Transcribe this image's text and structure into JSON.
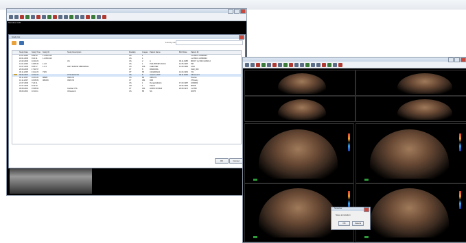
{
  "left_window": {
    "title": "",
    "meta_left": [
      "Sonoline G20",
      "",
      ""
    ],
    "meta_right": [
      "",
      "",
      ""
    ],
    "bottom_meta": [
      "",
      "",
      ""
    ]
  },
  "study_dialog": {
    "title": "Study list",
    "find_label": "Find by name:",
    "columns": [
      "Study Date",
      "Study Time",
      "Study ID",
      "Study Description",
      "Modality",
      "Images",
      "Patient Name",
      "Birth Date",
      "Patient ID"
    ],
    "rows": [
      [
        "11.01.2000",
        "8:55:02",
        "1.2.840.113",
        "",
        "US",
        "1",
        "",
        "",
        "1.2.826.0.1.3680043"
      ],
      [
        "18.01.2000",
        "9:14:11",
        "1.2.840.113",
        "",
        "US",
        "1",
        "",
        "",
        "1.2.826.0.1.3680043"
      ],
      [
        "21.02.2000",
        "10:43:23",
        "",
        "US",
        "US",
        "2",
        "A",
        "09.11.1958",
        "MR/CT 1.2.840.113619.2"
      ],
      [
        "11.04.2000",
        "13:56:33",
        "1.2.8",
        "",
        "US",
        "1",
        "PHILIPPINES FACE",
        "12.05.1987",
        "PM"
      ],
      [
        "01.07.2005",
        "8:06:07",
        "1.2.3",
        "LEFT ELBOW ABNORMAL",
        "US",
        "166",
        "CHESTER",
        "12.09.1980",
        "1234"
      ],
      [
        "20.09.2005",
        "17:31:57",
        "",
        "",
        "CT",
        "8",
        "PANDORA",
        "",
        "0110_000"
      ],
      [
        "30.11.2005",
        "13:12:23",
        "7329",
        "",
        "OT",
        "68",
        "CANADIANA",
        "12.04.1962",
        "721"
      ],
      [
        "09.06.2007",
        "10:22:22",
        "",
        "CTS obstetrics",
        "US",
        "5",
        "Anatoma FAT",
        "09.11.2003",
        "Ultrasound"
      ],
      [
        "06.11.2007",
        "10:03:26",
        "88885",
        "OB/GYN",
        "US",
        "88",
        "OB/GYN",
        "",
        "Precise"
      ],
      [
        "16.11.2007",
        "16:08:09",
        "084066",
        "OB/GYN",
        "CT",
        "481",
        "PAB",
        "",
        "FTFreely"
      ],
      [
        "21.07.2009",
        "7:24:11",
        "",
        "",
        "US",
        "1",
        "Rumpelstiltskin",
        "17.03.1987",
        "1093093"
      ],
      [
        "07.07.2009",
        "8:44:30",
        "",
        "",
        "CR",
        "1",
        "Patient",
        "02.05.1983",
        "86578"
      ],
      [
        "30.08.2010",
        "15:38:02",
        "",
        "Cardiac CTA",
        "CT",
        "341",
        "HOFIS DOOHR",
        "20.09.1972",
        "1.2.826"
      ],
      [
        "09.09.2010",
        "10:11:11",
        "",
        "Ultrasound",
        "US",
        "88",
        "NA",
        "",
        "40076"
      ]
    ],
    "ok_label": "OK",
    "cancel_label": "Cancel"
  },
  "right_window": {
    "popup": {
      "title": "Sonoview",
      "message": "Save annotation",
      "ok_label": "OK",
      "cancel_label": "Cancel"
    }
  },
  "colors": {
    "titlebar": "#c8d5e6",
    "selection": "#d6e6f8",
    "tissue": "#a07a5a",
    "marker": "#2e9a3a"
  }
}
